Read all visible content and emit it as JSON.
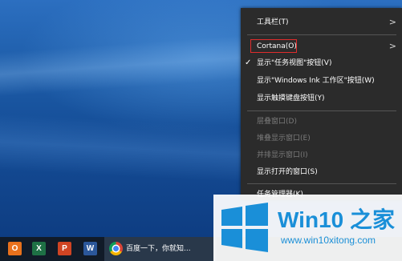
{
  "context_menu": {
    "items": [
      {
        "label": "工具栏(T)",
        "submenu": true,
        "enabled": true
      },
      {
        "label": "Cortana(O)",
        "submenu": true,
        "enabled": true,
        "highlighted": true
      },
      {
        "label": "显示\"任务视图\"按钮(V)",
        "checked": true,
        "enabled": true
      },
      {
        "label": "显示\"Windows Ink 工作区\"按钮(W)",
        "enabled": true
      },
      {
        "label": "显示触摸键盘按钮(Y)",
        "enabled": true
      },
      {
        "label": "层叠窗口(D)",
        "enabled": false
      },
      {
        "label": "堆叠显示窗口(E)",
        "enabled": false
      },
      {
        "label": "并排显示窗口(I)",
        "enabled": false
      },
      {
        "label": "显示打开的窗口(S)",
        "enabled": true
      },
      {
        "label": "任务管理器(K)",
        "enabled": true
      }
    ],
    "arrow_glyph": ">",
    "check_glyph": "✓"
  },
  "taskbar": {
    "pinned": [
      {
        "name": "outlook",
        "glyph": "O",
        "color": "#e8711c"
      },
      {
        "name": "excel",
        "glyph": "X",
        "color": "#1e7145"
      },
      {
        "name": "powerpoint",
        "glyph": "P",
        "color": "#d04423"
      },
      {
        "name": "word",
        "glyph": "W",
        "color": "#2b579a"
      }
    ],
    "active_window": {
      "title": "百度一下，你就知..."
    }
  },
  "watermark": {
    "title": "Win10 之家",
    "url": "www.win10xitong.com"
  },
  "colors": {
    "menu_bg": "#2b2b2b",
    "highlight_border": "#e02c2c",
    "watermark_blue": "#1a8fd8"
  }
}
